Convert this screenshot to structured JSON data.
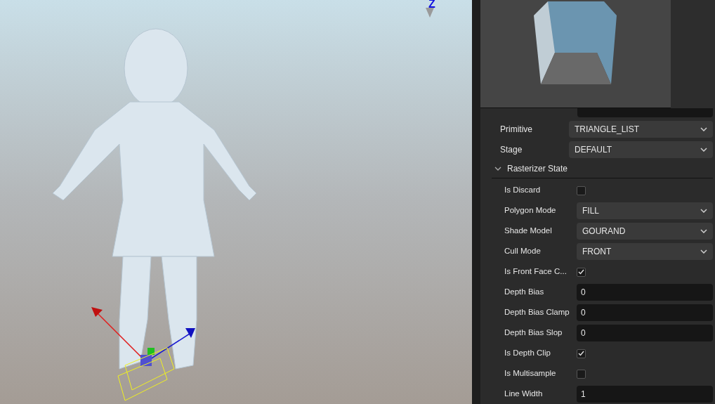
{
  "viewport": {
    "axis_label": "Z"
  },
  "properties": [
    {
      "kind": "select",
      "label": "Primitive",
      "value": "TRIANGLE_LIST"
    },
    {
      "kind": "select",
      "label": "Stage",
      "value": "DEFAULT"
    }
  ],
  "section": {
    "title": "Rasterizer State",
    "expanded": true,
    "properties": [
      {
        "kind": "checkbox",
        "label": "Is Discard",
        "checked": false
      },
      {
        "kind": "select",
        "label": "Polygon Mode",
        "value": "FILL"
      },
      {
        "kind": "select",
        "label": "Shade Model",
        "value": "GOURAND"
      },
      {
        "kind": "select",
        "label": "Cull Mode",
        "value": "FRONT"
      },
      {
        "kind": "checkbox",
        "label": "Is Front Face C...",
        "checked": true
      },
      {
        "kind": "number",
        "label": "Depth Bias",
        "value": "0"
      },
      {
        "kind": "number",
        "label": "Depth Bias Clamp",
        "value": "0"
      },
      {
        "kind": "number",
        "label": "Depth Bias Slop",
        "value": "0"
      },
      {
        "kind": "checkbox",
        "label": "Is Depth Clip",
        "checked": true
      },
      {
        "kind": "checkbox",
        "label": "Is Multisample",
        "checked": false
      },
      {
        "kind": "number",
        "label": "Line Width",
        "value": "1"
      }
    ]
  }
}
